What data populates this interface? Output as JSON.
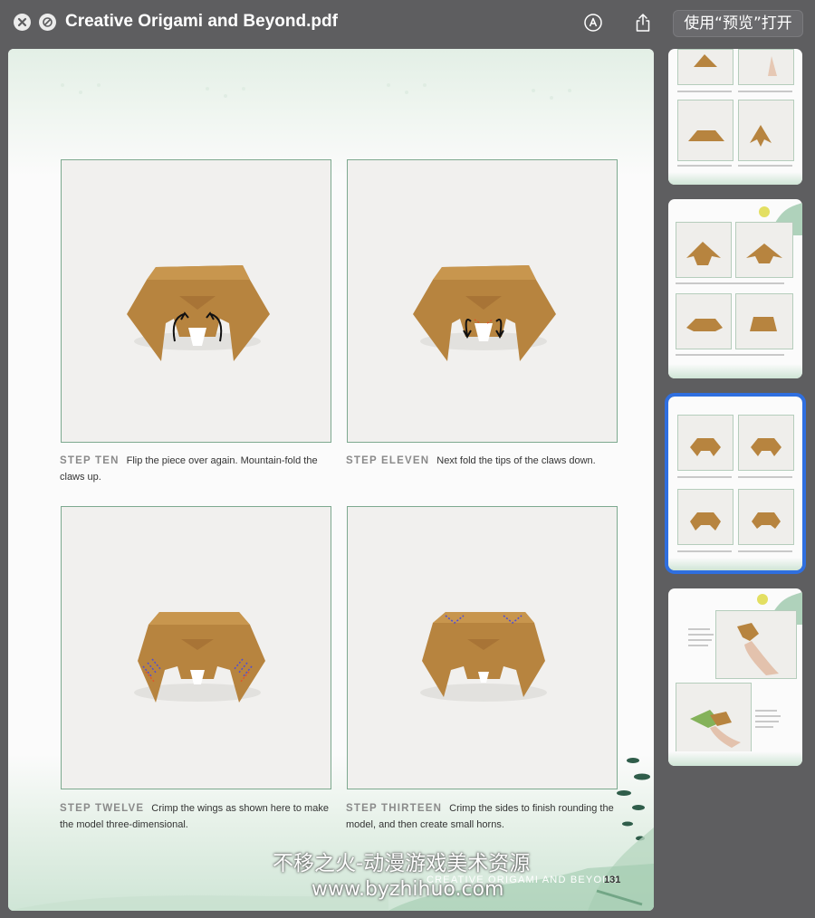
{
  "window": {
    "title": "Creative Origami and Beyond.pdf",
    "open_with_label": "使用“预览”打开",
    "icons": [
      "close-icon",
      "block-icon",
      "markup-icon",
      "share-icon"
    ]
  },
  "page": {
    "steps": [
      {
        "label": "STEP TEN",
        "text": "Flip the piece over again. Mountain-fold the claws up."
      },
      {
        "label": "STEP ELEVEN",
        "text": "Next fold the tips of the claws down."
      },
      {
        "label": "STEP TWELVE",
        "text": "Crimp the wings as shown here to make the model three-dimensional."
      },
      {
        "label": "STEP THIRTEEN",
        "text": "Crimp the sides to finish rounding the model, and then create small horns."
      }
    ],
    "footer_title": "CREATIVE ORIGAMI AND BEYOND",
    "page_number": "131",
    "watermark_line1": "不移之火-动漫游戏美术资源",
    "watermark_line2": "www.byzhihuo.com"
  },
  "sidebar": {
    "selected_index": 2,
    "thumbnails": [
      "page-129",
      "page-130",
      "page-131",
      "page-132"
    ]
  },
  "colors": {
    "accent_selected": "#2f6fe0",
    "paper_origami": "#b9853f",
    "frame_green": "#7da98f"
  }
}
